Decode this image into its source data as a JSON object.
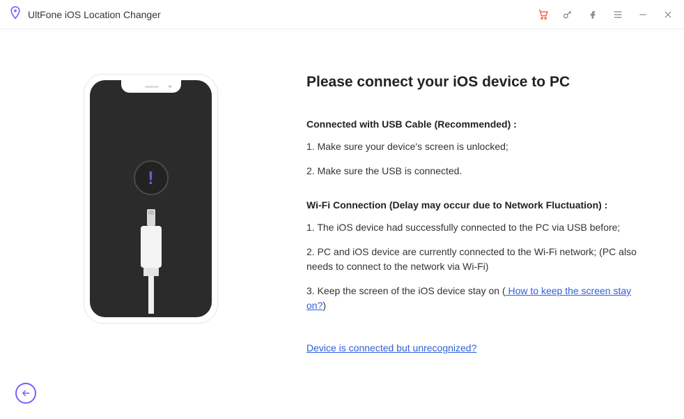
{
  "titlebar": {
    "app_name": "UltFone iOS Location Changer"
  },
  "heading": "Please connect your iOS device to PC",
  "usb": {
    "title": "Connected with USB Cable (Recommended) :",
    "step1": "1. Make sure your device's screen is unlocked;",
    "step2": "2. Make sure the USB is connected."
  },
  "wifi": {
    "title": "Wi-Fi Connection (Delay may occur due to Network Fluctuation) :",
    "step1": "1. The iOS device had successfully connected to the PC via USB before;",
    "step2": "2. PC and iOS device are currently connected to the Wi-Fi network; (PC also needs to connect to the network via Wi-Fi)",
    "step3_pre": "3. Keep the screen of the iOS device stay on  (",
    "step3_link": " How to keep the screen stay on?",
    "step3_post": ")"
  },
  "unrecognized_link": "Device is connected but unrecognized?"
}
